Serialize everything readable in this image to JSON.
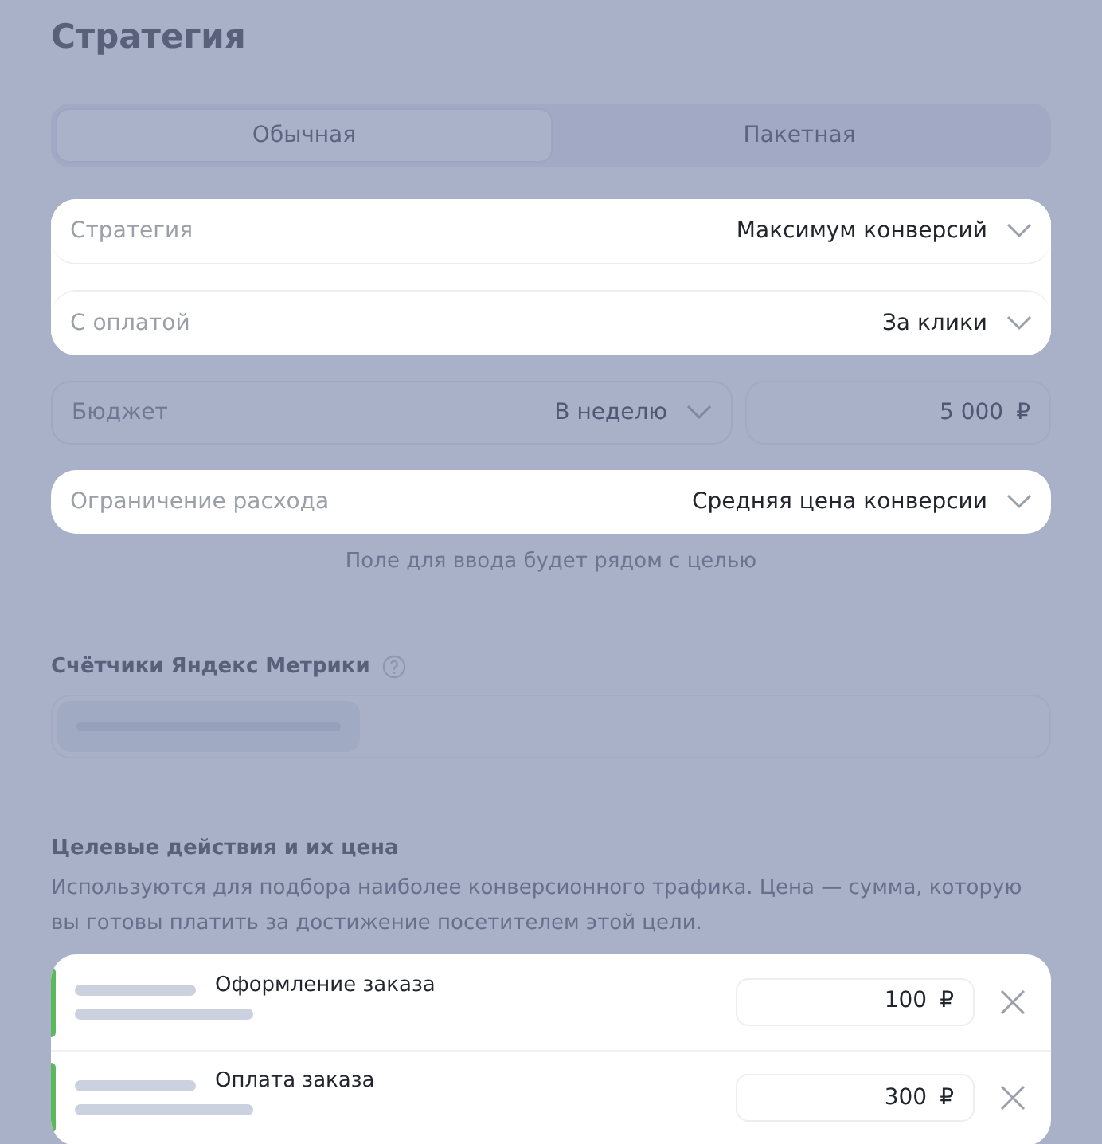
{
  "title": "Стратегия",
  "tabs": [
    {
      "label": "Обычная",
      "selected": true
    },
    {
      "label": "Пакетная",
      "selected": false
    }
  ],
  "select_group": [
    {
      "label": "Стратегия",
      "value": "Максимум конверсий",
      "highlighted": true
    },
    {
      "label": "С оплатой",
      "value": "За клики",
      "highlighted": true
    }
  ],
  "budget": {
    "label": "Бюджет",
    "period": "В неделю",
    "amount": "5 000",
    "currency": "₽",
    "highlighted": false
  },
  "spend_limit": {
    "label": "Ограничение расхода",
    "value": "Средняя цена конверсии",
    "highlighted": true
  },
  "spend_limit_hint": "Поле для ввода будет рядом с целью",
  "metrics": {
    "label": "Счётчики Яндекс Метрики",
    "help": true
  },
  "goals": {
    "title": "Целевые действия и их цена",
    "description": "Используются для подбора наиболее конверсионного трафика. Цена — сумма, которую вы готовы платить за достижение посетителем этой цели.",
    "items": [
      {
        "name": "Оформление заказа",
        "price": "100",
        "currency": "₽",
        "color": "#5cb85c"
      },
      {
        "name": "Оплата заказа",
        "price": "300",
        "currency": "₽",
        "color": "#5cb85c"
      }
    ]
  }
}
